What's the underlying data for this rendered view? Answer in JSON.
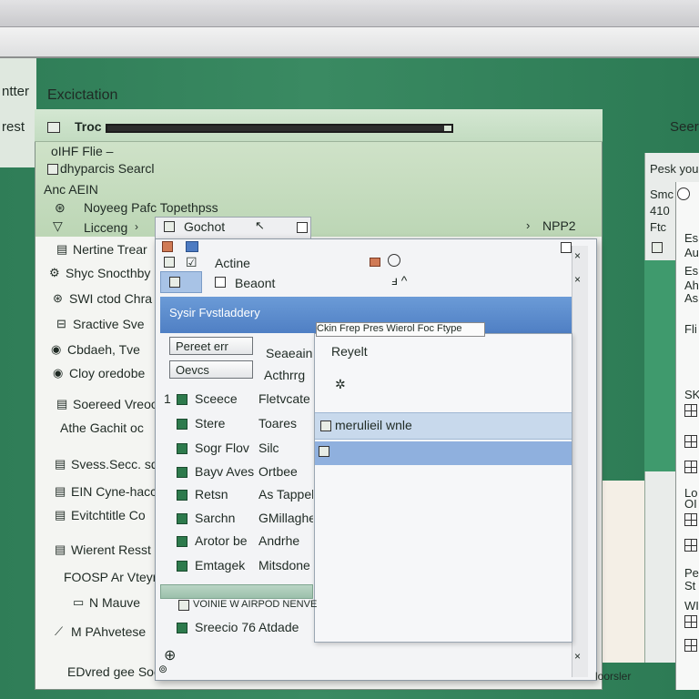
{
  "background_labels": {
    "top_left_1": "ntter",
    "top_left_2": "rest",
    "top_title": "Excictation",
    "top_right": "Seer"
  },
  "explorer": {
    "title": "Troc",
    "progress_fraction": 0.98,
    "menu_item_1": "oIHF Flie –",
    "menu_item_2": "dhyparcis Searcl",
    "breadcrumb": "Anc AEIN",
    "nav_1": "Noyeeg Pafc Topethpss",
    "nav_2": "Licceng",
    "nav_right": "NPP2"
  },
  "sidebar": {
    "items": [
      {
        "label": "Nertine Trear"
      },
      {
        "label": "Shyc Snocthby"
      },
      {
        "label": "SWI ctod Chra"
      },
      {
        "label": "Sractive Sve"
      },
      {
        "label": "Cbdaeh, Tve"
      },
      {
        "label": "Cloy oredobe"
      },
      {
        "label": "Soereed Vreoo"
      },
      {
        "label": "Athe Gachit oc"
      },
      {
        "label": "Svess.Secc. sd"
      },
      {
        "label": "EIN Cyne-hacc"
      },
      {
        "label": "Evitchtitle Co"
      },
      {
        "label": "Wierent Resst"
      },
      {
        "label": "FOOSP Ar Vteyrr"
      },
      {
        "label": "N Mauve"
      },
      {
        "label": "M PAhvetese"
      },
      {
        "label": "EDvred gee Socg"
      }
    ]
  },
  "dialog": {
    "tab_label": "Gochot",
    "row_actine": "Actine",
    "row_beaont": "Beaont",
    "selected_title": "Sysir Fvstladdery",
    "tooltip": "Ckin Frep Pres Wierol Foc Ftype",
    "btn_1": "Pereet err",
    "btn_2": "Oevcs",
    "label_1": "Seaeain",
    "label_2": "Acthrrg",
    "list": [
      {
        "left": "Sceece",
        "right": "Fletvcate"
      },
      {
        "left": "Stere",
        "right": "Toares"
      },
      {
        "left": "Sogr Flov",
        "right": "Silc"
      },
      {
        "left": "Bayv Aves",
        "right": "Ortbee"
      },
      {
        "left": "Retsn",
        "right": "As Tappelaye"
      },
      {
        "left": "Sarchn",
        "right": "GMillaghes"
      },
      {
        "left": "Arotor be",
        "right": "Andrhe"
      },
      {
        "left": "Emtagek",
        "right": "Mitsdone"
      }
    ],
    "list_prefix": "1",
    "status_strip": "VOINIE W AIRPOD NENVE",
    "bottom_row": "Sreecio 76 Atdade"
  },
  "popup": {
    "item_1": "Reyelt",
    "item_2": "merulieil wnle"
  },
  "right_panel": {
    "header": "Pesk you",
    "sm": "Smc",
    "num": "410",
    "ftc": "Ftc",
    "e1": "Es",
    "e2": "Au",
    "e3": "Es",
    "e4": "Ah",
    "e5": "As",
    "fi": "Fli",
    "sk": "SK",
    "lo": "Lo",
    "ol": "OI",
    "pe": "Pe",
    "st": "St",
    "wi": "WI"
  },
  "footer": {
    "status": "loorsler"
  }
}
